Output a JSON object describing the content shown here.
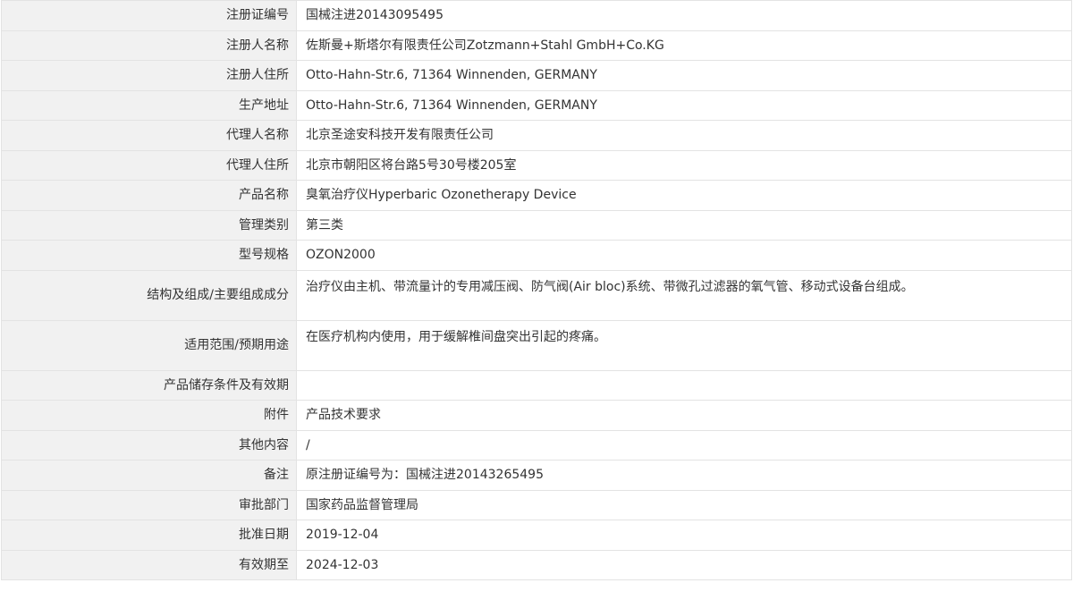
{
  "rows": [
    {
      "label": "注册证编号",
      "value": "国械注进20143095495"
    },
    {
      "label": "注册人名称",
      "value": "佐斯曼+斯塔尔有限责任公司Zotzmann+Stahl GmbH+Co.KG"
    },
    {
      "label": "注册人住所",
      "value": "Otto-Hahn-Str.6, 71364 Winnenden, GERMANY"
    },
    {
      "label": "生产地址",
      "value": "Otto-Hahn-Str.6, 71364 Winnenden, GERMANY"
    },
    {
      "label": "代理人名称",
      "value": "北京圣途安科技开发有限责任公司"
    },
    {
      "label": "代理人住所",
      "value": "北京市朝阳区将台路5号30号楼205室"
    },
    {
      "label": "产品名称",
      "value": "臭氧治疗仪Hyperbaric Ozonetherapy Device"
    },
    {
      "label": "管理类别",
      "value": "第三类"
    },
    {
      "label": "型号规格",
      "value": "OZON2000"
    },
    {
      "label": "结构及组成/主要组成成分",
      "value": "治疗仪由主机、带流量计的专用减压阀、防气阀(Air bloc)系统、带微孔过滤器的氧气管、移动式设备台组成。"
    },
    {
      "label": "适用范围/预期用途",
      "value": "在医疗机构内使用，用于缓解椎间盘突出引起的疼痛。"
    },
    {
      "label": "产品储存条件及有效期",
      "value": ""
    },
    {
      "label": "附件",
      "value": "产品技术要求"
    },
    {
      "label": "其他内容",
      "value": "/"
    },
    {
      "label": "备注",
      "value": "原注册证编号为：国械注进20143265495"
    },
    {
      "label": "审批部门",
      "value": "国家药品监督管理局"
    },
    {
      "label": "批准日期",
      "value": "2019-12-04"
    },
    {
      "label": "有效期至",
      "value": "2024-12-03"
    }
  ]
}
